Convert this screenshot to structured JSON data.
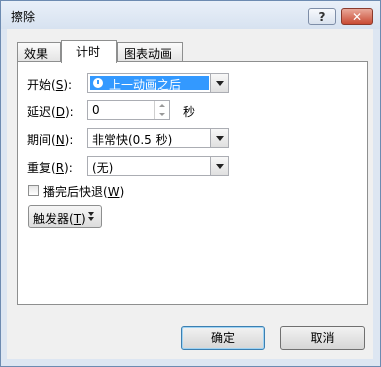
{
  "window": {
    "title": "擦除"
  },
  "titlebar": {
    "help_label": "?",
    "close_label": "✕"
  },
  "tabs": [
    {
      "label": "效果"
    },
    {
      "label": "计时"
    },
    {
      "label": "图表动画"
    }
  ],
  "form": {
    "start": {
      "label": "开始(",
      "mnemonic": "S",
      "suffix": "):",
      "value": "上一动画之后"
    },
    "delay": {
      "label": "延迟(",
      "mnemonic": "D",
      "suffix": "):",
      "value": "0",
      "unit": "秒"
    },
    "period": {
      "label": "期间(",
      "mnemonic": "N",
      "suffix": "):",
      "value": "非常快(0.5 秒)"
    },
    "repeat": {
      "label": "重复(",
      "mnemonic": "R",
      "suffix": "):",
      "value": "(无)"
    },
    "rewind": {
      "label": "播完后快退(",
      "mnemonic": "W",
      "suffix": ")",
      "checked": false
    }
  },
  "trigger": {
    "label": "触发器(",
    "mnemonic": "T",
    "suffix": ")"
  },
  "buttons": {
    "ok": "确定",
    "cancel": "取消"
  },
  "colors": {
    "accent": "#3399ff",
    "titlebar": "#dde6f2",
    "close": "#c94a33"
  }
}
